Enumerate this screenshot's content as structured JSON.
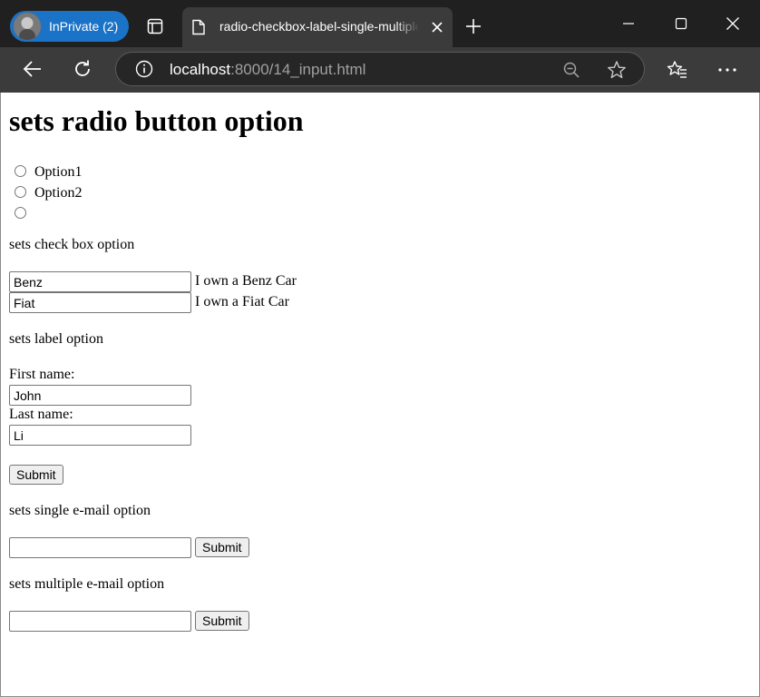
{
  "browser": {
    "profile_label": "InPrivate (2)",
    "tab_title": "radio-checkbox-label-single-multiple",
    "url_host": "localhost",
    "url_path": ":8000/14_input.html",
    "icons": {
      "tab_actions": "tab-actions-icon",
      "tab": "document-icon",
      "tab_close": "close-icon",
      "new_tab": "plus-icon",
      "back": "back-arrow-icon",
      "reload": "reload-icon",
      "info": "info-icon",
      "zoom": "zoom-out-icon",
      "favorite": "star-icon",
      "favorites": "favorites-icon",
      "menu": "more-icon"
    },
    "colors": {
      "chrome": "#202020",
      "toolbar": "#3b3b3b",
      "profile": "#1a73c7"
    }
  },
  "page": {
    "heading": "sets radio button option",
    "radio": {
      "options": [
        "Option1",
        "Option2",
        ""
      ]
    },
    "checkbox_section": {
      "title": "sets check box option",
      "items": [
        {
          "value": "Benz",
          "label": "I own a Benz Car"
        },
        {
          "value": "Fiat",
          "label": "I own a Fiat Car"
        }
      ]
    },
    "label_section": {
      "title": "sets label option",
      "first_label": "First name:",
      "first_value": "John",
      "last_label": "Last name:",
      "last_value": "Li",
      "submit": "Submit"
    },
    "single_email": {
      "title": "sets single e-mail option",
      "value": "",
      "submit": "Submit"
    },
    "multiple_email": {
      "title": "sets multiple e-mail option",
      "value": "",
      "submit": "Submit"
    }
  }
}
